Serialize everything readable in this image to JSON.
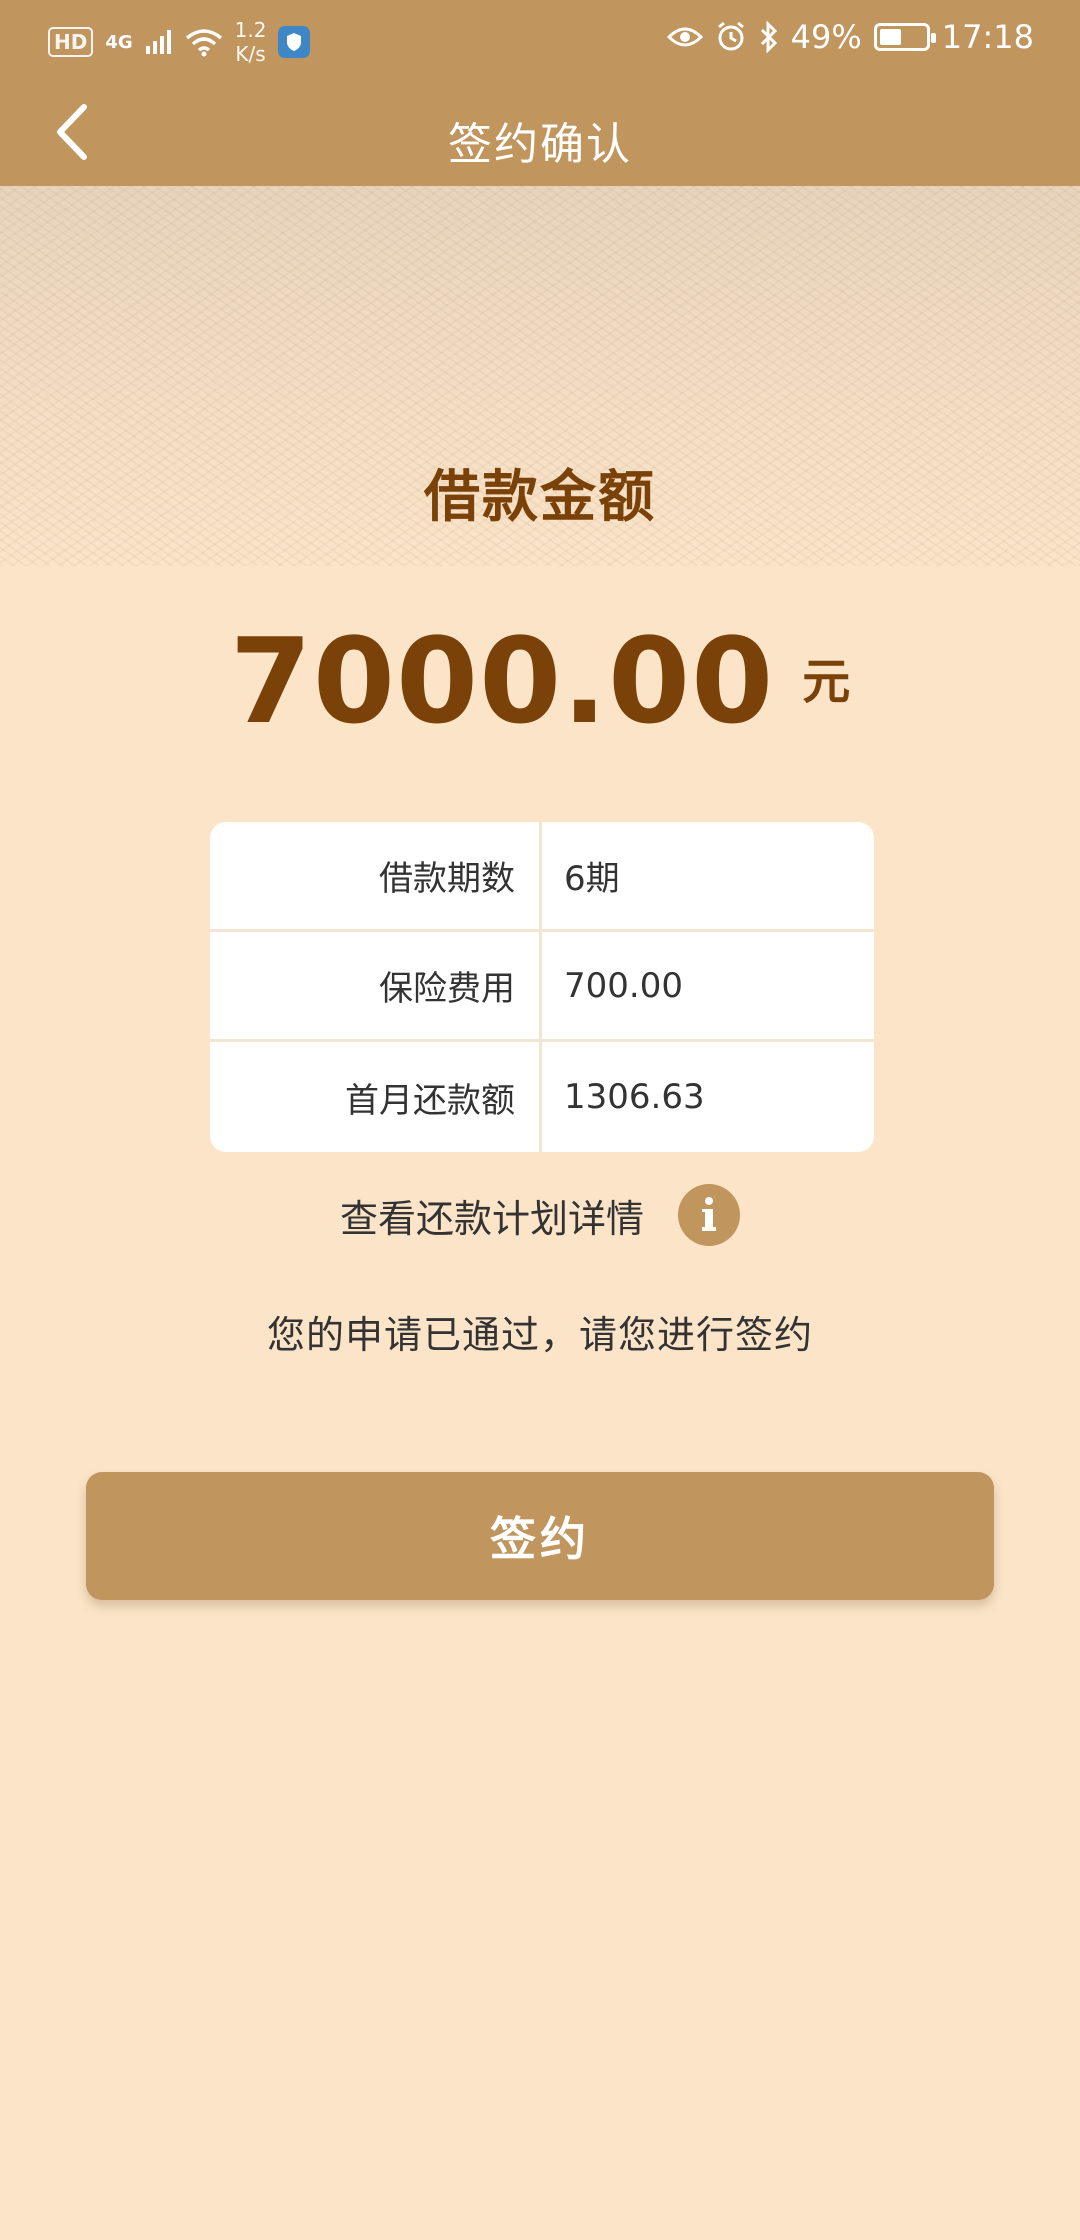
{
  "status_bar": {
    "hd": "HD",
    "network": "4G",
    "speed_value": "1.2",
    "speed_unit": "K/s",
    "battery_percent": "49%",
    "battery_level": 0.49,
    "time": "17:18"
  },
  "header": {
    "title": "签约确认"
  },
  "loan": {
    "label": "借款金额",
    "amount": "7000.00",
    "unit": "元"
  },
  "details": [
    {
      "label": "借款期数",
      "value": "6期"
    },
    {
      "label": "保险费用",
      "value": "700.00"
    },
    {
      "label": "首月还款额",
      "value": "1306.63"
    }
  ],
  "plan_link": {
    "label": "查看还款计划详情"
  },
  "approval_message": "您的申请已通过，请您进行签约",
  "sign_button": {
    "label": "签约"
  },
  "colors": {
    "primary": "#c0955e",
    "text_brown": "#7a4108",
    "background": "#fbe4c8"
  },
  "icons": [
    "hd-icon",
    "signal-icon",
    "wifi-icon",
    "shield-icon",
    "eye-icon",
    "alarm-icon",
    "bluetooth-icon",
    "battery-icon",
    "back-arrow-icon",
    "info-icon"
  ]
}
